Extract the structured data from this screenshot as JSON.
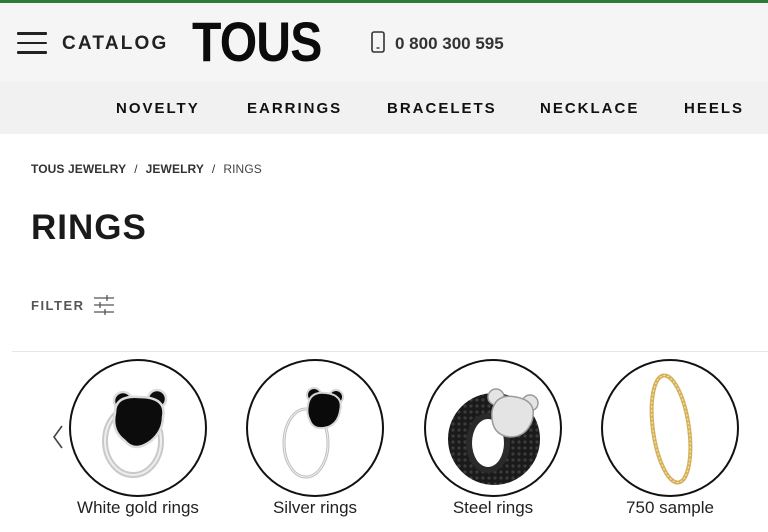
{
  "header": {
    "catalog_label": "CATALOG",
    "logo_text": "TOUS",
    "phone": "0 800 300 595"
  },
  "nav": {
    "items": [
      "NOVELTY",
      "EARRINGS",
      "BRACELETS",
      "NECKLACE",
      "HEELS"
    ]
  },
  "breadcrumb": {
    "items": [
      "TOUS JEWELRY",
      "JEWELRY",
      "RINGS"
    ],
    "separator": "/"
  },
  "page": {
    "title": "RINGS",
    "filter_label": "FILTER"
  },
  "categories": [
    {
      "label": "White gold rings",
      "icon": "white-gold-bear-ring"
    },
    {
      "label": "Silver rings",
      "icon": "silver-bear-ring"
    },
    {
      "label": "Steel rings",
      "icon": "black-steel-ring"
    },
    {
      "label": "750 sample",
      "icon": "gold-band-ring"
    }
  ],
  "colors": {
    "accent_topline": "#2d7a3a",
    "header_bg": "#f5f5f5",
    "nav_bg": "#f1f1f1"
  }
}
